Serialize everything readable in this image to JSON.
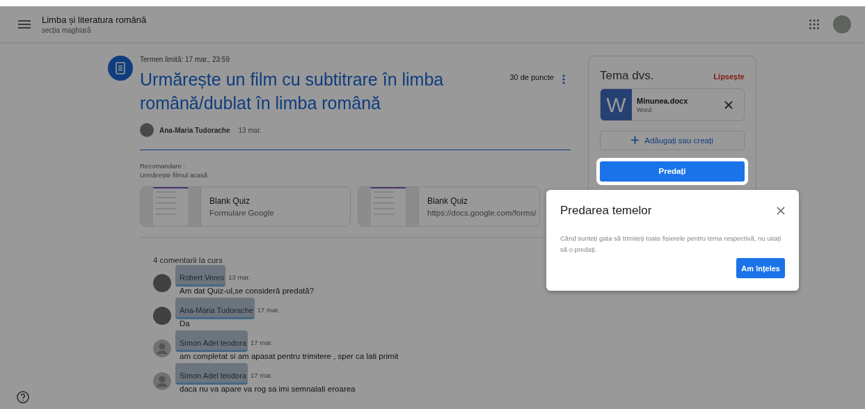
{
  "header": {
    "title": "Limba și literatura română",
    "subtitle": "secția maghiară"
  },
  "assignment": {
    "deadline": "Termen limită: 17 mar., 23:59",
    "title": "Urmărește un film cu subtitrare în limba română/dublat în limba română",
    "points": "30 de puncte",
    "author": "Ana-Maria Tudorache",
    "date": "13 mar.",
    "notes": [
      "Recomandare :",
      "Urmărește filmul acasă"
    ],
    "attachments": [
      {
        "title": "Blank Quiz",
        "subtitle": "Formulare Google"
      },
      {
        "title": "Blank Quiz",
        "subtitle": "https://docs.google.com/forms/"
      }
    ]
  },
  "comments": {
    "heading": "4 comentarii la curs",
    "items": [
      {
        "author": "Robert Veres",
        "date": "13 mar.",
        "text": "Am dat Quiz-ul,se consideră predată?",
        "kind": "photo",
        "redacted": true
      },
      {
        "author": "Ana-Maria Tudorache",
        "date": "17 mar.",
        "text": "Da",
        "kind": "photo",
        "redacted": true
      },
      {
        "author": "Simon Adel teodora",
        "date": "17 mar.",
        "text": "am completat si am apasat pentru trimitere , sper ca lati primit",
        "kind": "default",
        "redacted": true
      },
      {
        "author": "Simon Adel teodora",
        "date": "17 mar.",
        "text": "daca nu va apare va rog sa imi semnalati eroarea",
        "kind": "default",
        "redacted": true
      }
    ]
  },
  "work": {
    "title": "Tema dvs.",
    "status": "Lipsește",
    "file": {
      "name": "Minunea.docx",
      "type": "Word",
      "letter": "W"
    },
    "add_button": "Adăugați sau creați",
    "submit_button": "Predați"
  },
  "dialog": {
    "title": "Predarea temelor",
    "text": "Când sunteți gata să trimiteți toate fișierele pentru tema respectivă, nu uitați să o predați.",
    "button": "Am înțeles"
  }
}
